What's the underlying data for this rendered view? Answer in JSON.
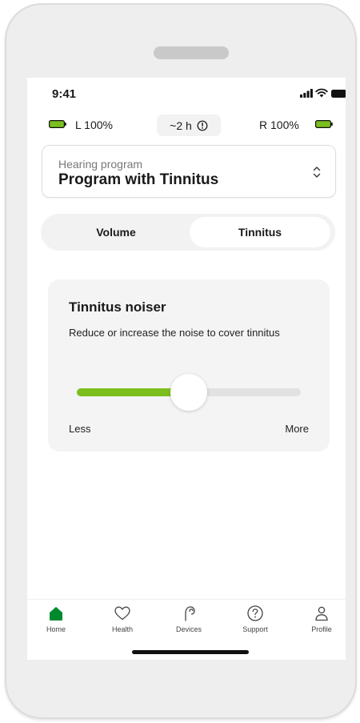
{
  "status_bar": {
    "time": "9:41"
  },
  "battery": {
    "left_label": "L 100%",
    "right_label": "R 100%",
    "runtime": "~2 h",
    "color": "#7bbf1e"
  },
  "program": {
    "label": "Hearing program",
    "name": "Program with Tinnitus"
  },
  "segment": {
    "tabs": [
      "Volume",
      "Tinnitus"
    ],
    "selected": "Tinnitus"
  },
  "tinnitus_noiser": {
    "title": "Tinnitus noiser",
    "description": "Reduce or increase the noise to cover tinnitus",
    "level": 0.5,
    "min_label": "Less",
    "max_label": "More"
  },
  "tab_bar": {
    "items": [
      {
        "label": "Home",
        "icon": "home-icon"
      },
      {
        "label": "Health",
        "icon": "heart-icon"
      },
      {
        "label": "Devices",
        "icon": "hearing-aid-icon"
      },
      {
        "label": "Support",
        "icon": "help-icon"
      },
      {
        "label": "Profile",
        "icon": "person-icon"
      }
    ],
    "selected": "Home",
    "accent": "#008a2e"
  },
  "colors": {
    "accent_green": "#7bbf1e",
    "home_green": "#008a2e"
  }
}
